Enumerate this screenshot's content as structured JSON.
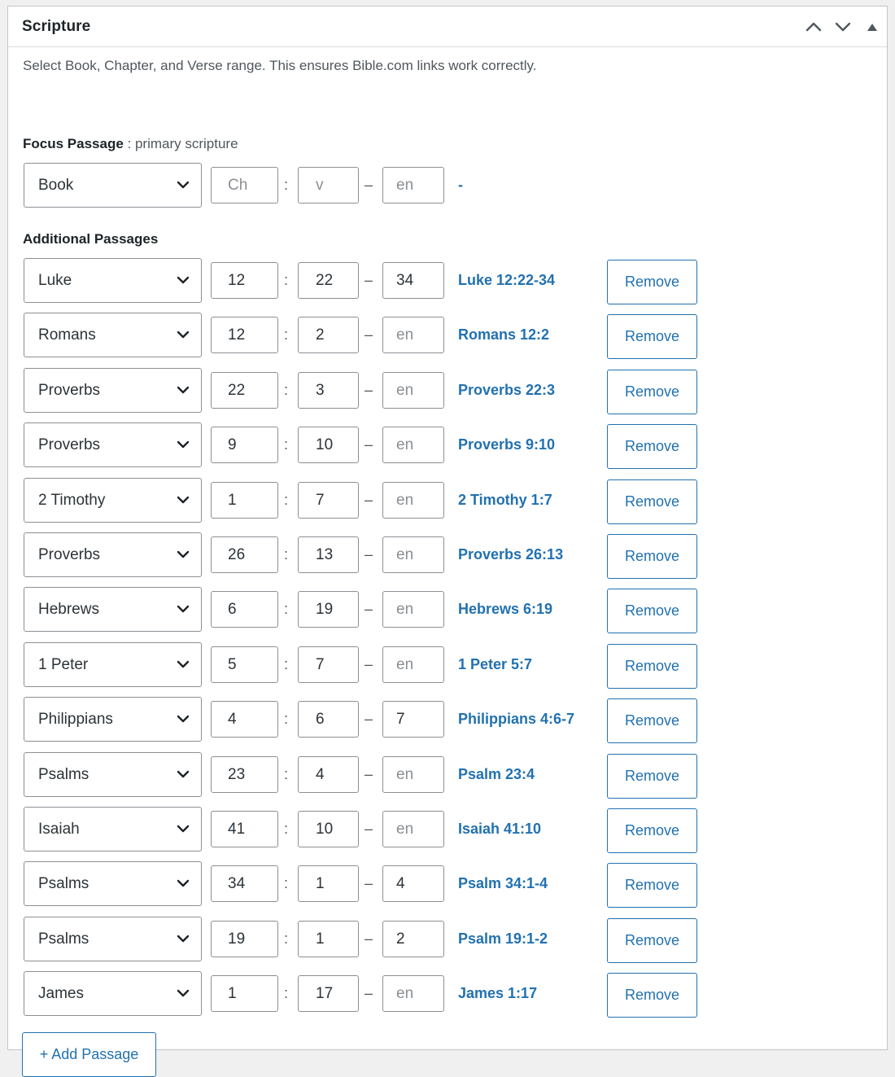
{
  "metabox": {
    "title": "Scripture",
    "controls": [
      {
        "name": "move-up-button",
        "icon": "chevron-up-icon"
      },
      {
        "name": "move-down-button",
        "icon": "chevron-down-icon"
      },
      {
        "name": "toggle-panel-button",
        "icon": "triangle-up-icon"
      }
    ]
  },
  "description": "Select Book, Chapter, and Verse range. This ensures Bible.com links work correctly.",
  "focus": {
    "label": "Focus Passage",
    "sublabel": " : primary scripture",
    "book": "Book",
    "chapter_placeholder": "Ch",
    "verse_placeholder": "v",
    "verse_end_placeholder": "en",
    "colon": ":",
    "dash": "–",
    "link": "-"
  },
  "additional": {
    "label": "Additional Passages",
    "colon": ":",
    "dash": "–",
    "end_placeholder": "en",
    "remove_label": "Remove",
    "passages": [
      {
        "book": "Luke",
        "chapter": "12",
        "verse": "22",
        "verse_end": "34",
        "link": "Luke 12:22-34"
      },
      {
        "book": "Romans",
        "chapter": "12",
        "verse": "2",
        "verse_end": "",
        "link": "Romans 12:2"
      },
      {
        "book": "Proverbs",
        "chapter": "22",
        "verse": "3",
        "verse_end": "",
        "link": "Proverbs 22:3"
      },
      {
        "book": "Proverbs",
        "chapter": "9",
        "verse": "10",
        "verse_end": "",
        "link": "Proverbs 9:10"
      },
      {
        "book": "2 Timothy",
        "chapter": "1",
        "verse": "7",
        "verse_end": "",
        "link": "2 Timothy 1:7"
      },
      {
        "book": "Proverbs",
        "chapter": "26",
        "verse": "13",
        "verse_end": "",
        "link": "Proverbs 26:13"
      },
      {
        "book": "Hebrews",
        "chapter": "6",
        "verse": "19",
        "verse_end": "",
        "link": "Hebrews 6:19"
      },
      {
        "book": "1 Peter",
        "chapter": "5",
        "verse": "7",
        "verse_end": "",
        "link": "1 Peter 5:7"
      },
      {
        "book": "Philippians",
        "chapter": "4",
        "verse": "6",
        "verse_end": "7",
        "link": "Philippians 4:6-7"
      },
      {
        "book": "Psalms",
        "chapter": "23",
        "verse": "4",
        "verse_end": "",
        "link": "Psalm 23:4"
      },
      {
        "book": "Isaiah",
        "chapter": "41",
        "verse": "10",
        "verse_end": "",
        "link": "Isaiah 41:10"
      },
      {
        "book": "Psalms",
        "chapter": "34",
        "verse": "1",
        "verse_end": "4",
        "link": "Psalm 34:1-4"
      },
      {
        "book": "Psalms",
        "chapter": "19",
        "verse": "1",
        "verse_end": "2",
        "link": "Psalm 19:1-2"
      },
      {
        "book": "James",
        "chapter": "1",
        "verse": "17",
        "verse_end": "",
        "link": "James 1:17"
      }
    ]
  },
  "add_button": "+ Add Passage",
  "colors": {
    "accent": "#2271b1",
    "border": "#8c8f94",
    "text": "#1d2327",
    "muted": "#50575e"
  }
}
